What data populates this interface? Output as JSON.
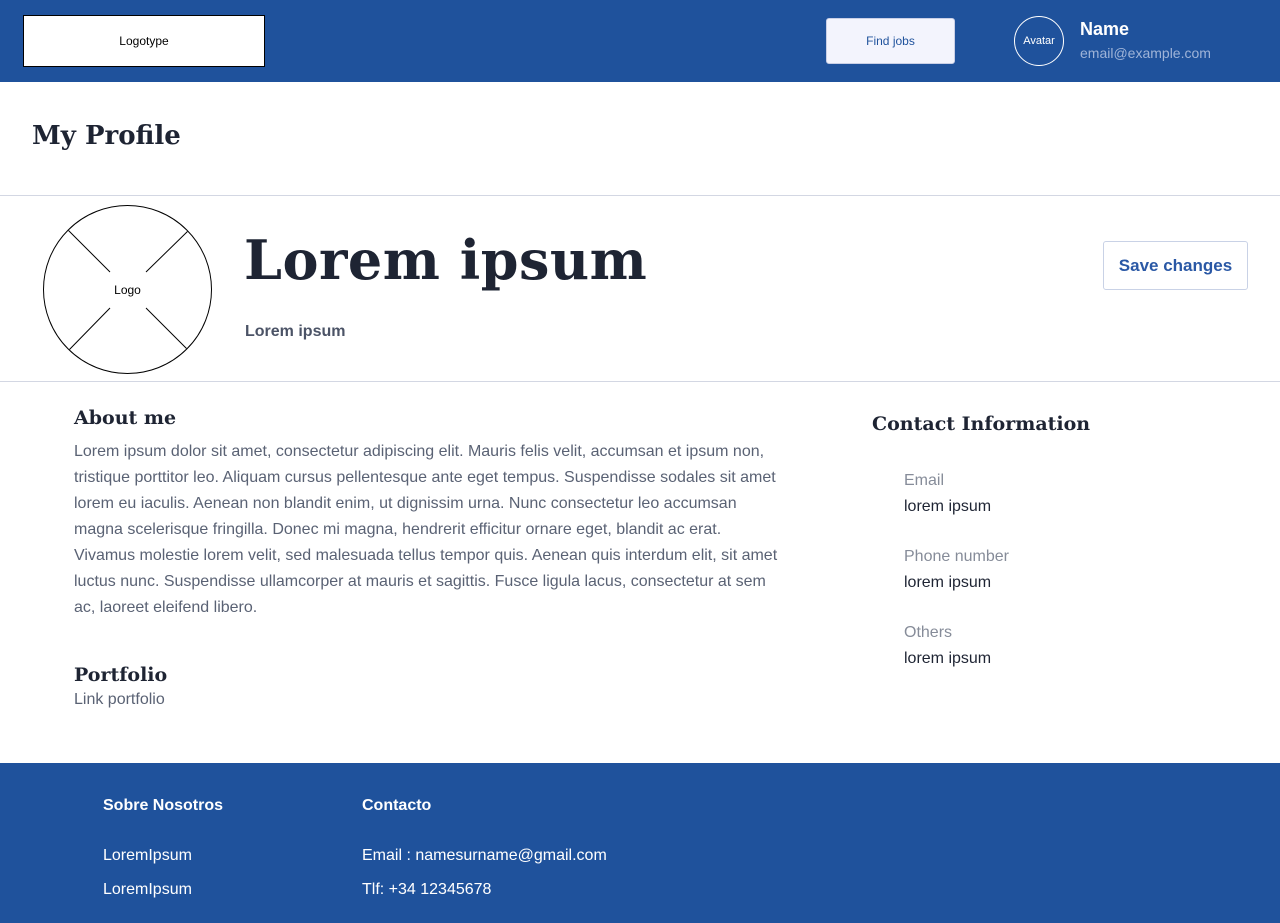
{
  "header": {
    "logotype": "Logotype",
    "find_jobs": "Find jobs",
    "avatar": "Avatar",
    "user_name": "Name",
    "user_email": "email@example.com"
  },
  "page": {
    "title": "My Profile"
  },
  "profile": {
    "logo_label": "Logo",
    "name": "Lorem ipsum",
    "subtitle": "Lorem ipsum",
    "save_label": "Save changes"
  },
  "about": {
    "title": "About me",
    "text": "Lorem ipsum dolor sit amet, consectetur adipiscing elit. Mauris felis velit, accumsan et ipsum non, tristique porttitor leo. Aliquam cursus pellentesque ante eget tempus. Suspendisse sodales sit amet lorem eu iaculis. Aenean non blandit enim, ut dignissim urna. Nunc consectetur leo accumsan magna scelerisque fringilla. Donec mi magna, hendrerit efficitur ornare eget, blandit ac erat. Vivamus molestie lorem velit, sed malesuada tellus tempor quis. Aenean quis interdum elit, sit amet luctus nunc. Suspendisse ullamcorper at mauris et sagittis. Fusce ligula lacus, consectetur at sem ac, laoreet eleifend libero.",
    "portfolio_title": "Portfolio",
    "portfolio_link": "Link portfolio"
  },
  "contact": {
    "title": "Contact Information",
    "items": [
      {
        "label": "Email",
        "value": "lorem ipsum"
      },
      {
        "label": "Phone number",
        "value": "lorem ipsum"
      },
      {
        "label": "Others",
        "value": "lorem ipsum"
      }
    ]
  },
  "footer": {
    "about_title": "Sobre Nosotros",
    "about_items": [
      "LoremIpsum",
      "LoremIpsum"
    ],
    "contact_title": "Contacto",
    "contact_items": [
      "Email : namesurname@gmail.com",
      "Tlf: +34 12345678"
    ]
  },
  "colors": {
    "primary": "#1f529c",
    "text_dark": "#1e2433",
    "text_muted": "#5a6274",
    "accent_button": "#2a58a5"
  }
}
